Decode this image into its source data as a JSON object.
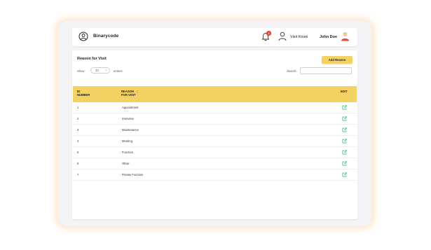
{
  "header": {
    "brand": "Binarycode",
    "notification_count": "3",
    "visit_kiosk_label": "Visit Kiosk",
    "user_name": "John Doe"
  },
  "page": {
    "title": "Reason for Visit",
    "add_button_label": "Add Reason"
  },
  "table_controls": {
    "show_label": "Show",
    "entries_value": "10",
    "entries_label": "entries",
    "search_label": "Search:",
    "search_value": ""
  },
  "table": {
    "columns": {
      "id_line1": "ID",
      "id_line2": "NUMBER",
      "reason_line1": "REASON",
      "reason_line2": "FOR VISIT",
      "edit": "EDIT"
    },
    "rows": [
      {
        "id": "1",
        "reason": "Appointment"
      },
      {
        "id": "2",
        "reason": "Interview"
      },
      {
        "id": "3",
        "reason": "Maintenance"
      },
      {
        "id": "4",
        "reason": "Meeting"
      },
      {
        "id": "5",
        "reason": "Function"
      },
      {
        "id": "6",
        "reason": "Other"
      },
      {
        "id": "7",
        "reason": "Private Function"
      }
    ]
  },
  "colors": {
    "accent": "#f3d163",
    "badge": "#e53935",
    "edit_icon": "#2bb673",
    "frame_glow": "#ffb25a"
  },
  "icons": {
    "logo": "user-circle-icon",
    "notifications": "bell-icon",
    "kiosk": "user-icon",
    "avatar": "avatar-icon",
    "edit": "edit-icon",
    "sort": "sort-arrows-icon"
  }
}
